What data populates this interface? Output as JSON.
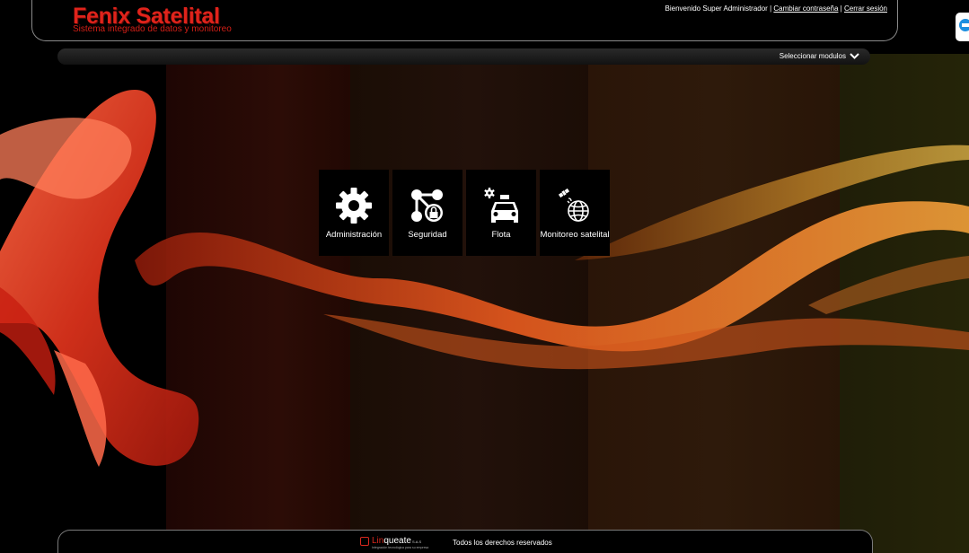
{
  "header": {
    "logo_title": "Fenix Satelital",
    "logo_subtitle": "Sistema integrado de datos y monitoreo",
    "welcome": "Bienvenido Super Administrador",
    "separator": "|",
    "change_password": "Cambiar contraseña",
    "logout": "Cerrar sesión"
  },
  "module_bar": {
    "selector_label": "Seleccionar modulos",
    "selector_icon": "chevron-down-icon"
  },
  "modules": [
    {
      "label": "Administración",
      "icon": "gear-icon"
    },
    {
      "label": "Seguridad",
      "icon": "network-lock-icon"
    },
    {
      "label": "Flota",
      "icon": "taxi-gear-icon"
    },
    {
      "label": "Monitoreo satelital",
      "icon": "satellite-globe-icon"
    }
  ],
  "footer": {
    "company_name_first": "Lin",
    "company_name_rest": "queate",
    "company_suffix": "S.A.S",
    "company_tagline": "Integración tecnológica para su empresa",
    "copyright": "Todos los derechos reservados"
  },
  "colors": {
    "brand_red": "#e0231b",
    "tile_bg": "#000000",
    "wave_orange": "#e8571e"
  }
}
